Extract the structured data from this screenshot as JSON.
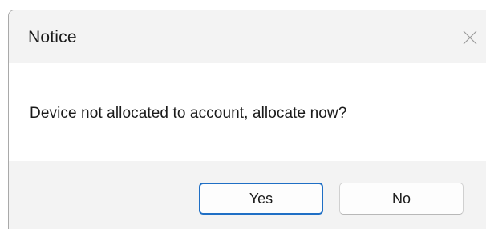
{
  "dialog": {
    "title": "Notice",
    "close_icon": "close-icon",
    "message": "Device not allocated to account, allocate now?",
    "buttons": {
      "yes_label": "Yes",
      "no_label": "No"
    }
  },
  "colors": {
    "focus_border": "#1f6fc5",
    "titlebar_bg": "#f3f3f3",
    "content_bg": "#ffffff"
  }
}
